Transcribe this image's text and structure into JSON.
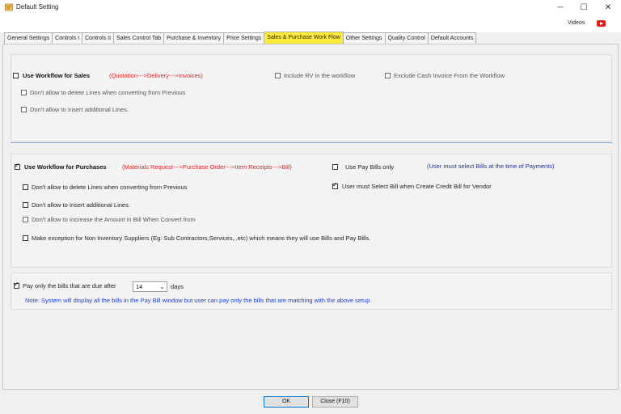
{
  "window": {
    "title": "Default Setting",
    "minimize_glyph": "─",
    "maximize_glyph": "☐",
    "close_glyph": "✕"
  },
  "topbar": {
    "videos_label": "Videos",
    "youtube_icon": "youtube-icon",
    "youtube_color": "#e02020"
  },
  "tabs": [
    {
      "label": "General Settings"
    },
    {
      "label": "Controls I"
    },
    {
      "label": "Controls II"
    },
    {
      "label": "Sales Control Tab"
    },
    {
      "label": "Purchase & Inventory"
    },
    {
      "label": "Price Settings"
    },
    {
      "label": "Sales & Purchase Work Flow",
      "active": true
    },
    {
      "label": "Other Settings"
    },
    {
      "label": "Quality Control"
    },
    {
      "label": "Default Accounts"
    }
  ],
  "sales": {
    "use_workflow": {
      "label": "Use Workflow for Sales",
      "checked": false
    },
    "workflow_hint": "(Quotation--->Delivery--->Invoices)",
    "include_rv": {
      "label": "Include RV in the workflow",
      "checked": false
    },
    "exclude_cash": {
      "label": "Exclude Cash Invoice From the Workflow",
      "checked": false
    },
    "no_delete": {
      "label": "Don't allow to delete Lines when converting from Previous",
      "checked": false
    },
    "no_insert": {
      "label": "Don't allow to Insert additional Lines.",
      "checked": false
    }
  },
  "purchases": {
    "use_workflow": {
      "label": "Use Workflow for Purchases",
      "checked": true
    },
    "workflow_hint": "(Materials Request--->Purchase Order--->Item Receipts--->Bill)",
    "use_pay_bills": {
      "label": "Use Pay Bills only",
      "checked": false
    },
    "pay_bills_hint": "(User must select Bills at the time of Payments)",
    "no_delete": {
      "label": "Don't allow to delete Lines when converting from Previous",
      "checked": false
    },
    "must_select_bill": {
      "label": "User must Select Bill when Create Credit Bill for Vendor",
      "checked": true
    },
    "no_insert": {
      "label": "Don't allow to Insert additional Lines.",
      "checked": false
    },
    "no_increase": {
      "label": "Don't allow to Increase the Amount in Bill When Convert from",
      "checked": false
    },
    "exception": {
      "label": "Make exception for Non Inventory Suppliers (Eg: Sub Contractors,Services,..etc) which means they will use Bills and Pay Bills.",
      "checked": false
    }
  },
  "paybills": {
    "due_after": {
      "label": "Pay only the bills that are due after",
      "checked": true
    },
    "days_value": "14",
    "days_unit": "days",
    "note": "Note: System will display all the bills in the Pay Bill window but user can pay only the bills that are matching with the above setup"
  },
  "footer": {
    "ok_label": "OK",
    "close_label": "Close (F10)"
  },
  "colors": {
    "active_tab": "#ffeb3b",
    "hint_red": "#e02424",
    "note_blue": "#1a3fd6",
    "divider": "#7ea7cf"
  }
}
